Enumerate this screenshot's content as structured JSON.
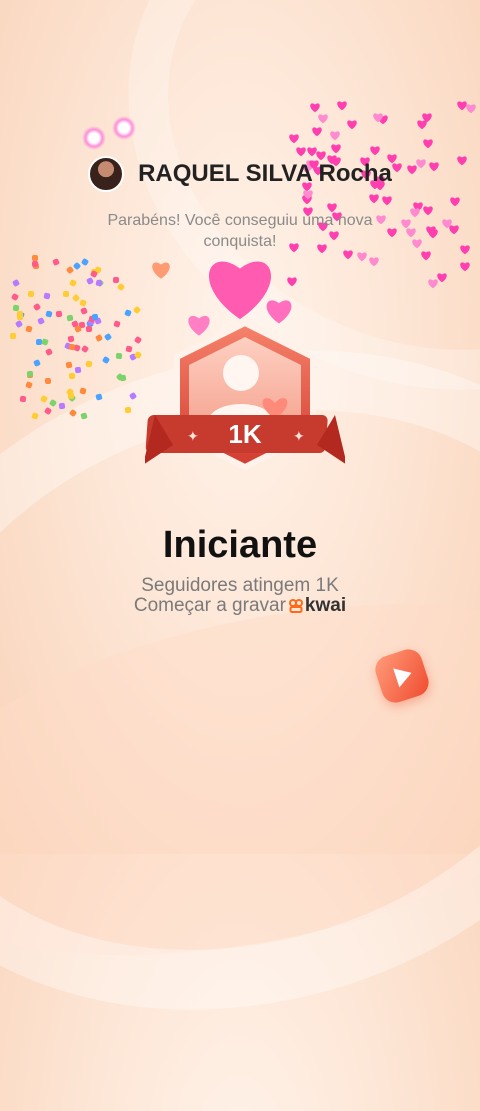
{
  "header": {
    "username": "RAQUEL SILVA Rocha",
    "congrats": "Parabéns! Você conseguiu uma nova conquista!"
  },
  "badge": {
    "count_label": "1K",
    "icon": "person-achievement-icon"
  },
  "achievement": {
    "title": "Iniciante",
    "desc": "Seguidores atingem 1K",
    "cta": "Começar a gravar",
    "brand": "kwai"
  },
  "colors": {
    "badge_red": "#d94b3b",
    "heart_pink": "#ff5bb0",
    "kwai_orange": "#ff6a1a"
  }
}
